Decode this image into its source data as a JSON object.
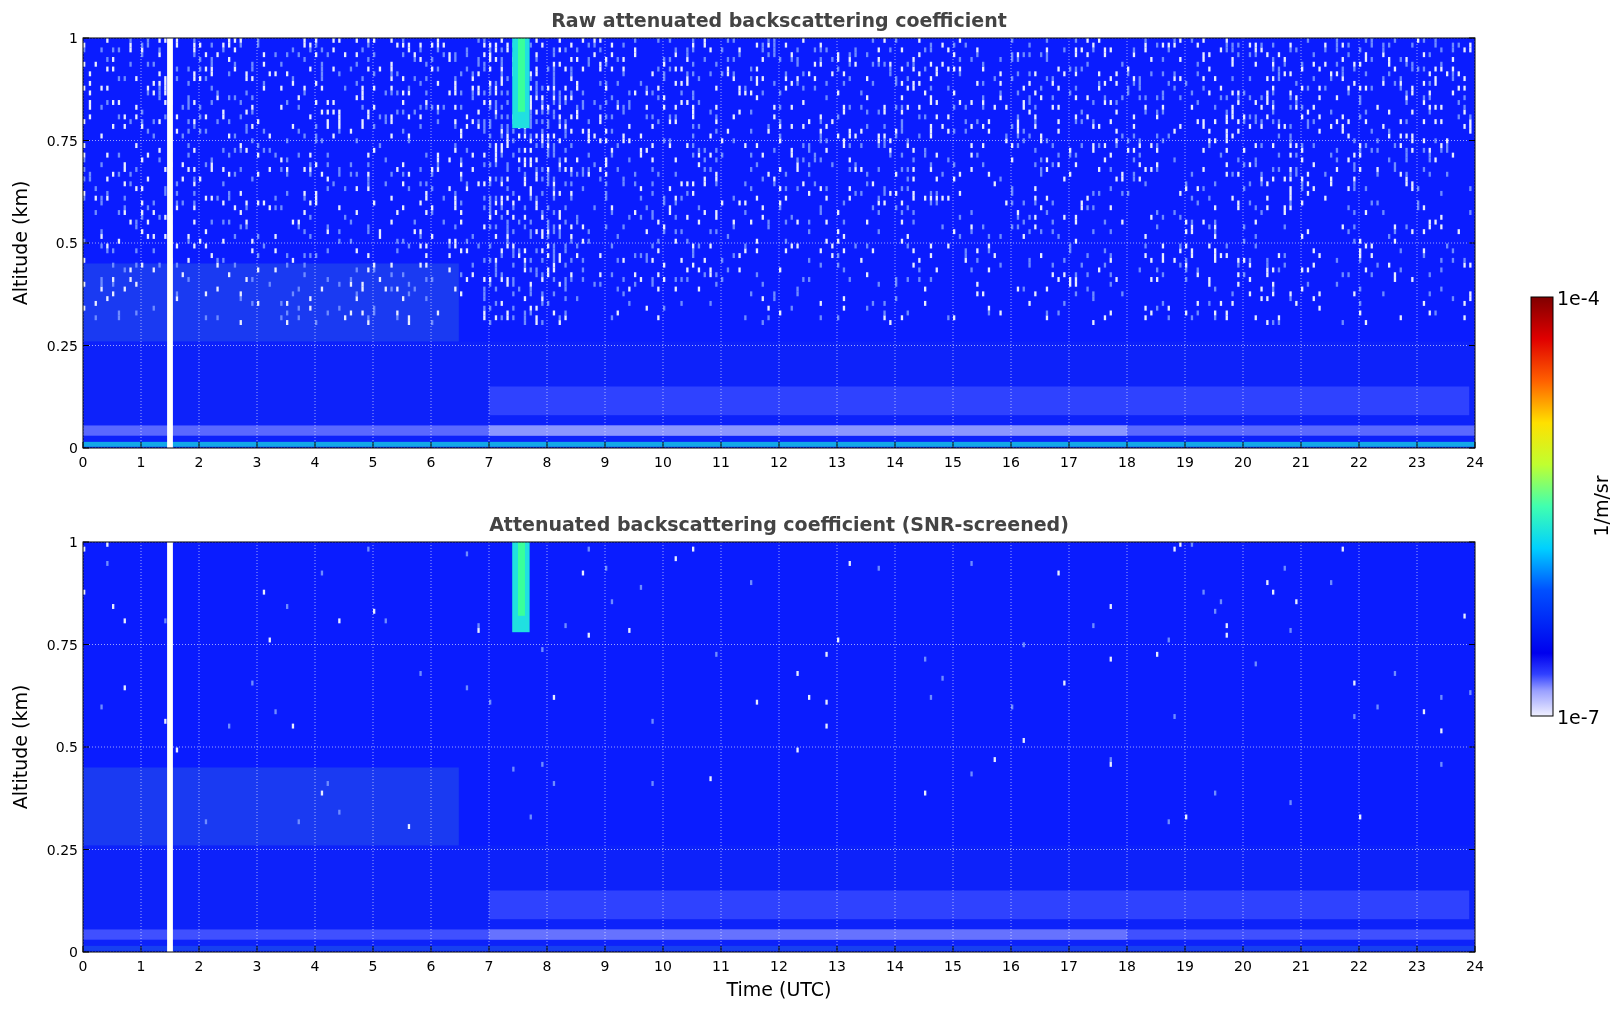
{
  "figure": {
    "panels": [
      {
        "kind": "raw",
        "title": "Raw attenuated backscattering coefficient",
        "ylabel": "Altitude (km)",
        "yticks": [
          "1",
          "0.75",
          "0.5",
          "0.25",
          "0"
        ],
        "xticks": [
          "0",
          "1",
          "2",
          "3",
          "4",
          "5",
          "6",
          "7",
          "8",
          "9",
          "10",
          "11",
          "12",
          "13",
          "14",
          "15",
          "16",
          "17",
          "18",
          "19",
          "20",
          "21",
          "22",
          "23",
          "24"
        ]
      },
      {
        "kind": "screened",
        "title": "Attenuated backscattering coefficient (SNR-screened)",
        "ylabel": "Altitude (km)",
        "yticks": [
          "1",
          "0.75",
          "0.5",
          "0.25",
          "0"
        ],
        "xticks": [
          "0",
          "1",
          "2",
          "3",
          "4",
          "5",
          "6",
          "7",
          "8",
          "9",
          "10",
          "11",
          "12",
          "13",
          "14",
          "15",
          "16",
          "17",
          "18",
          "19",
          "20",
          "21",
          "22",
          "23",
          "24"
        ],
        "xlabel": "Time (UTC)"
      }
    ],
    "colorbar": {
      "max": "1e-4",
      "min": "1e-7",
      "label": "1/m/sr"
    }
  }
}
